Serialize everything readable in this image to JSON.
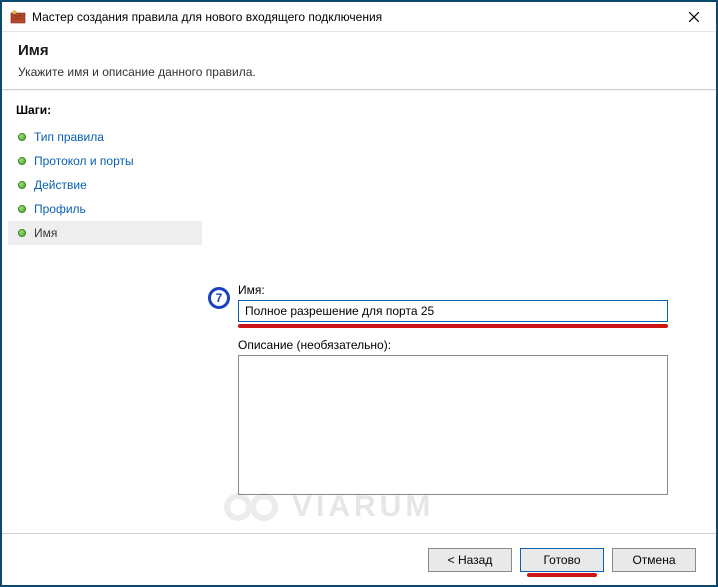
{
  "window": {
    "title": "Мастер создания правила для нового входящего подключения"
  },
  "header": {
    "title": "Имя",
    "subtitle": "Укажите имя и описание данного правила."
  },
  "sidebar": {
    "title": "Шаги:",
    "steps": [
      {
        "label": "Тип правила"
      },
      {
        "label": "Протокол и порты"
      },
      {
        "label": "Действие"
      },
      {
        "label": "Профиль"
      },
      {
        "label": "Имя"
      }
    ],
    "current_index": 4
  },
  "annotation": {
    "badge_number": "7"
  },
  "form": {
    "name_label": "Имя:",
    "name_value": "Полное разрешение для порта 25",
    "description_label": "Описание (необязательно):",
    "description_value": ""
  },
  "footer": {
    "back": "< Назад",
    "finish": "Готово",
    "cancel": "Отмена"
  },
  "watermark": {
    "text": "VIARUM"
  }
}
